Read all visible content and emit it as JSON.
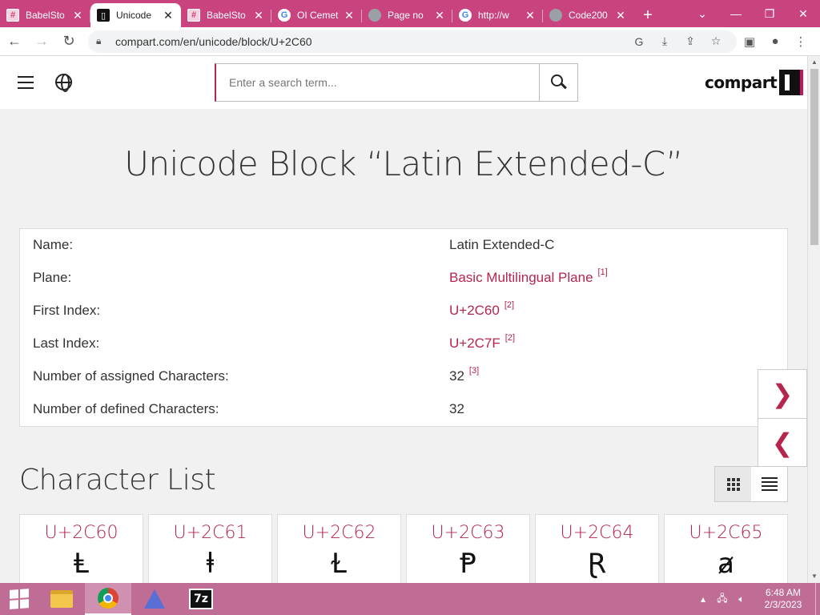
{
  "browser": {
    "tabs": [
      {
        "title": "BabelSto",
        "favicon": "babelstone-icon",
        "active": false
      },
      {
        "title": "Unicode",
        "favicon": "compart-icon",
        "active": true
      },
      {
        "title": "BabelSto",
        "favicon": "babelstone-icon",
        "active": false
      },
      {
        "title": "OI Cemet",
        "favicon": "google-icon",
        "active": false
      },
      {
        "title": "Page no",
        "favicon": "globe-icon",
        "active": false
      },
      {
        "title": "http://w",
        "favicon": "google-icon",
        "active": false
      },
      {
        "title": "Code200",
        "favicon": "globe-icon",
        "active": false
      }
    ],
    "url": "compart.com/en/unicode/block/U+2C60"
  },
  "site": {
    "search_placeholder": "Enter a search term...",
    "logo_text": "compart"
  },
  "page": {
    "title": "Unicode Block “Latin Extended-C”",
    "info": [
      {
        "key": "Name:",
        "value": "Latin Extended-C",
        "link": false,
        "ref": ""
      },
      {
        "key": "Plane:",
        "value": "Basic Multilingual Plane",
        "link": true,
        "ref": "[1]"
      },
      {
        "key": "First Index:",
        "value": "U+2C60",
        "link": true,
        "ref": "[2]"
      },
      {
        "key": "Last Index:",
        "value": "U+2C7F",
        "link": true,
        "ref": "[2]"
      },
      {
        "key": "Number of assigned Characters:",
        "value": "32",
        "link": false,
        "ref": "[3]"
      },
      {
        "key": "Number of defined Characters:",
        "value": "32",
        "link": false,
        "ref": ""
      }
    ],
    "section_title": "Character List",
    "characters": [
      {
        "code": "U+2C60",
        "glyph": "Ⱡ"
      },
      {
        "code": "U+2C61",
        "glyph": "ⱡ"
      },
      {
        "code": "U+2C62",
        "glyph": "Ɫ"
      },
      {
        "code": "U+2C63",
        "glyph": "Ᵽ"
      },
      {
        "code": "U+2C64",
        "glyph": "Ɽ"
      },
      {
        "code": "U+2C65",
        "glyph": "ⱥ"
      }
    ]
  },
  "taskbar": {
    "time": "6:48 AM",
    "date": "2/3/2023"
  },
  "colors": {
    "tabstrip": "#c9447f",
    "accent": "#b5254c",
    "taskbar": "#c06d96"
  }
}
